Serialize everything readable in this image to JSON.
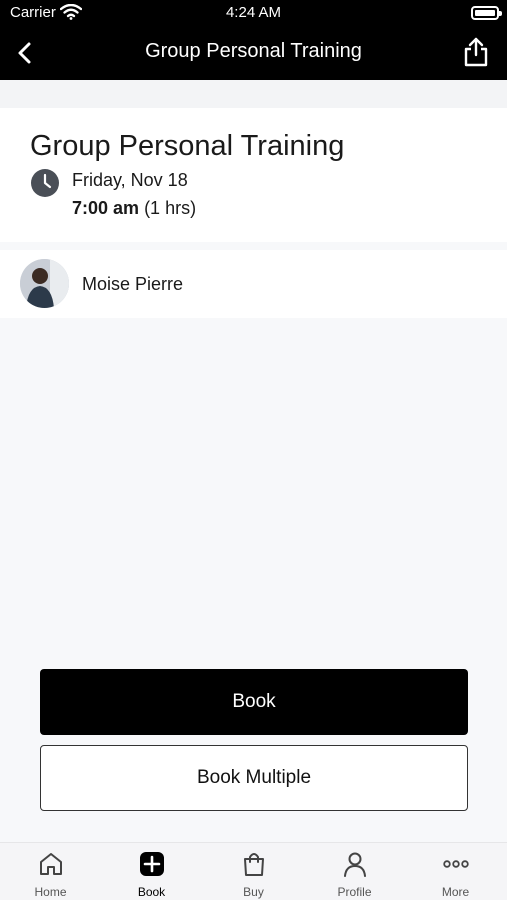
{
  "status_bar": {
    "carrier": "Carrier",
    "time": "4:24 AM"
  },
  "nav": {
    "title": "Group Personal Training",
    "back_icon": "chevron-left-icon",
    "share_icon": "share-icon"
  },
  "class_info": {
    "title": "Group Personal Training",
    "date": "Friday, Nov 18",
    "time": "7:00 am",
    "duration": "(1 hrs)"
  },
  "instructor": {
    "name": "Moise Pierre"
  },
  "actions": {
    "book_label": "Book",
    "book_multiple_label": "Book Multiple"
  },
  "tab_bar": {
    "active": "Book",
    "items": [
      {
        "label": "Home",
        "icon": "home-icon"
      },
      {
        "label": "Book",
        "icon": "plus-square-icon"
      },
      {
        "label": "Buy",
        "icon": "shopping-bag-icon"
      },
      {
        "label": "Profile",
        "icon": "person-icon"
      },
      {
        "label": "More",
        "icon": "ellipsis-icon"
      }
    ]
  },
  "colors": {
    "header_bg": "#000000",
    "primary_button": "#000000",
    "page_bg": "#f7f8fa"
  }
}
